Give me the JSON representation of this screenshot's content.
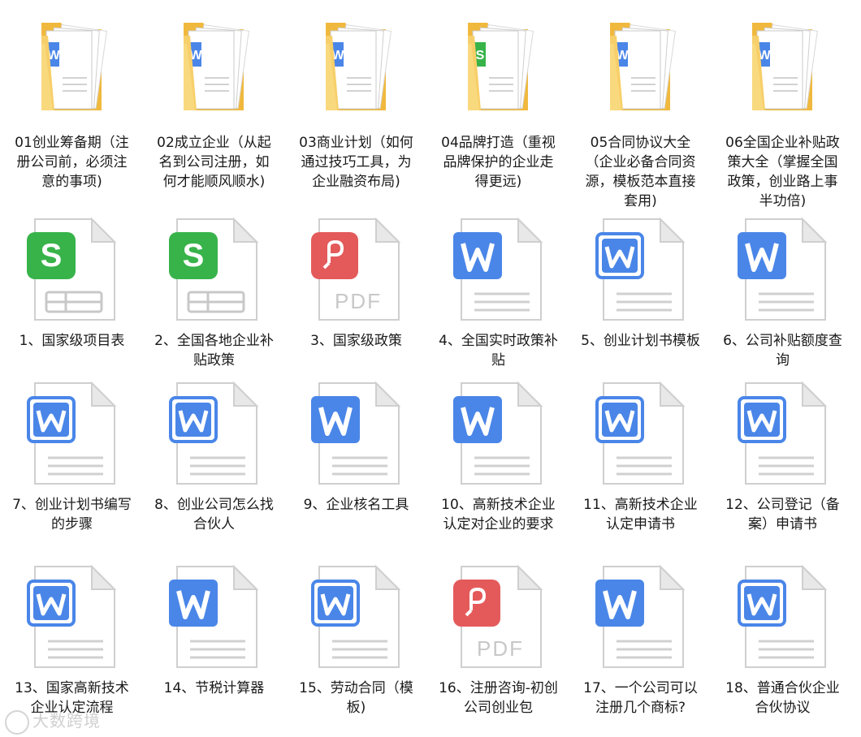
{
  "folders": [
    {
      "label": "01创业筹备期（注册公司前，必须注意的事项)",
      "badge": "W",
      "badge_color": "#4a86e8"
    },
    {
      "label": "02成立企业（从起名到公司注册，如何才能顺风顺水)",
      "badge": "W",
      "badge_color": "#4a86e8"
    },
    {
      "label": "03商业计划（如何通过技巧工具，为企业融资布局)",
      "badge": "W",
      "badge_color": "#4a86e8"
    },
    {
      "label": "04品牌打造（重视品牌保护的企业走得更远)",
      "badge": "S",
      "badge_color": "#38b34a"
    },
    {
      "label": "05合同协议大全（企业必备合同资源，模板范本直接套用)",
      "badge": "W",
      "badge_color": "#4a86e8"
    },
    {
      "label": "06全国企业补贴政策大全（掌握全国政策，创业路上事半功倍)",
      "badge": "W",
      "badge_color": "#4a86e8"
    }
  ],
  "files": [
    {
      "label": "1、国家级项目表",
      "type": "sheet"
    },
    {
      "label": "2、全国各地企业补贴政策",
      "type": "sheet"
    },
    {
      "label": "3、国家级政策",
      "type": "pdf"
    },
    {
      "label": "4、全国实时政策补贴",
      "type": "word-solid"
    },
    {
      "label": "5、创业计划书模板",
      "type": "word-outline"
    },
    {
      "label": "6、公司补贴额度查询",
      "type": "word-solid"
    },
    {
      "label": "7、创业计划书编写的步骤",
      "type": "word-outline"
    },
    {
      "label": "8、创业公司怎么找合伙人",
      "type": "word-outline"
    },
    {
      "label": "9、企业核名工具",
      "type": "word-solid"
    },
    {
      "label": "10、高新技术企业认定对企业的要求",
      "type": "word-solid"
    },
    {
      "label": "11、高新技术企业认定申请书",
      "type": "word-outline"
    },
    {
      "label": "12、公司登记（备案）申请书",
      "type": "word-outline"
    },
    {
      "label": "13、国家高新技术企业认定流程",
      "type": "word-outline"
    },
    {
      "label": "14、节税计算器",
      "type": "word-solid"
    },
    {
      "label": "15、劳动合同（模板)",
      "type": "word-outline"
    },
    {
      "label": "16、注册咨询-初创公司创业包",
      "type": "pdf"
    },
    {
      "label": "17、一个公司可以注册几个商标?",
      "type": "word-solid"
    },
    {
      "label": "18、普通合伙企业合伙协议",
      "type": "word-outline"
    }
  ],
  "icons": {
    "sheet_badge": "S",
    "word_badge": "W",
    "pdf_text": "PDF",
    "colors": {
      "word": "#4a86e8",
      "sheet": "#38b34a",
      "pdf": "#e45a5a",
      "folder": "#f5c659"
    }
  },
  "watermark": "大数跨境"
}
